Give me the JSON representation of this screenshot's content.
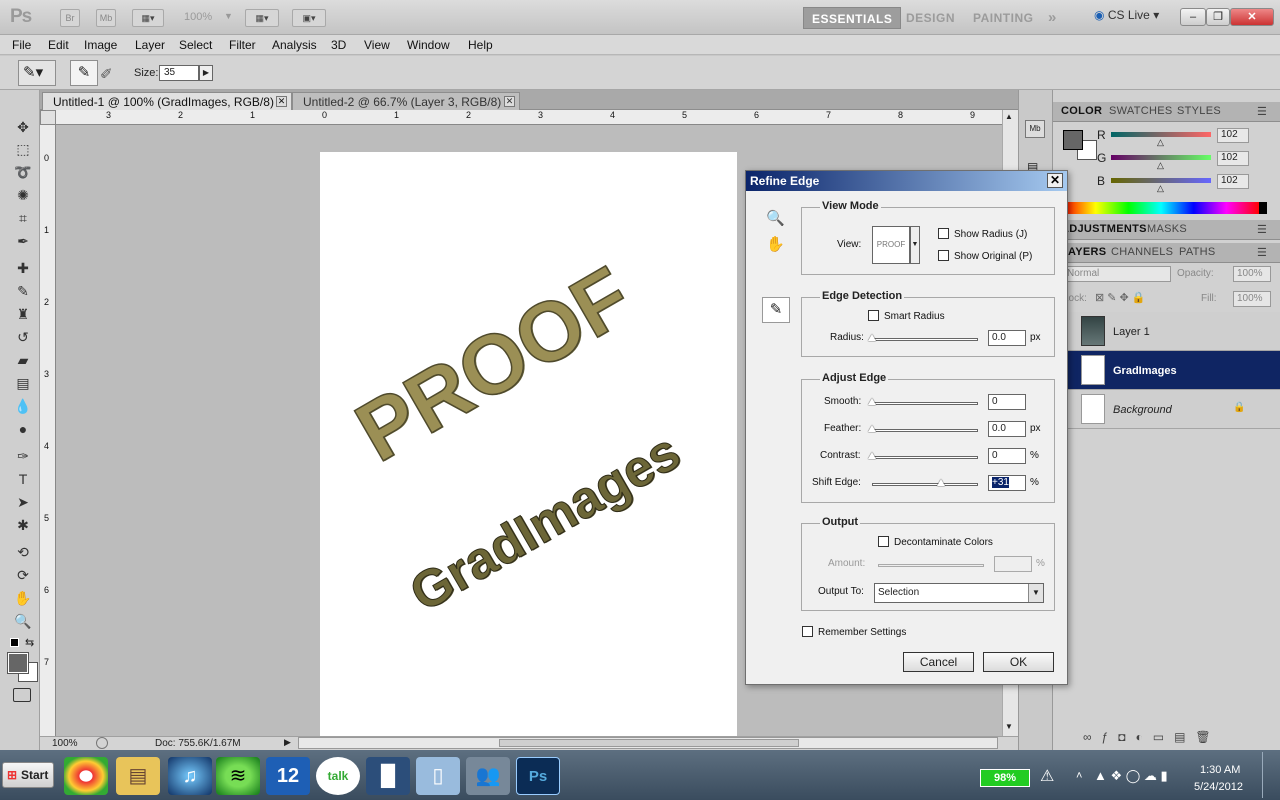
{
  "app": {
    "logo": "Ps",
    "br": "Br",
    "mb": "Mb",
    "zoom": "100%",
    "workspaces": [
      "ESSENTIALS",
      "DESIGN",
      "PAINTING"
    ],
    "more": "»",
    "cs_live": "CS Live"
  },
  "menu": [
    "File",
    "Edit",
    "Image",
    "Layer",
    "Select",
    "Filter",
    "Analysis",
    "3D",
    "View",
    "Window",
    "Help"
  ],
  "options": {
    "size_label": "Size:",
    "size_value": "35"
  },
  "tabs": [
    {
      "label": "Untitled-1 @ 100% (GradImages, RGB/8) *",
      "active": true
    },
    {
      "label": "Untitled-2 @ 66.7% (Layer 3, RGB/8) *",
      "active": false
    }
  ],
  "ruler_h": [
    "3",
    "2",
    "1",
    "0",
    "1",
    "2",
    "3",
    "4",
    "5",
    "6",
    "7",
    "8",
    "9"
  ],
  "ruler_v": [
    "0",
    "1",
    "2",
    "3",
    "4",
    "5",
    "6",
    "7"
  ],
  "canvas": {
    "line1": "PROOF",
    "line2": "GradImages"
  },
  "status": {
    "zoom": "100%",
    "doc": "Doc: 755.6K/1.67M"
  },
  "color_panel": {
    "tabs": [
      "COLOR",
      "SWATCHES",
      "STYLES"
    ],
    "r_label": "R",
    "g_label": "G",
    "b_label": "B",
    "r": "102",
    "g": "102",
    "b": "102"
  },
  "adjust_tabs": [
    "ADJUSTMENTS",
    "MASKS"
  ],
  "layers_panel": {
    "tabs": [
      "LAYERS",
      "CHANNELS",
      "PATHS"
    ],
    "blend": "Normal",
    "opacity_label": "Opacity:",
    "opacity": "100%",
    "lock_label": "Lock:",
    "fill_label": "Fill:",
    "fill": "100%",
    "layers": [
      "Layer 1",
      "GradImages",
      "Background"
    ]
  },
  "dialog": {
    "title": "Refine Edge",
    "view_mode": {
      "title": "View Mode",
      "view_label": "View:",
      "show_radius": "Show Radius (J)",
      "show_original": "Show Original (P)"
    },
    "edge_detection": {
      "title": "Edge Detection",
      "smart_radius": "Smart Radius",
      "radius_label": "Radius:",
      "radius": "0.0",
      "radius_unit": "px"
    },
    "adjust_edge": {
      "title": "Adjust Edge",
      "smooth_label": "Smooth:",
      "smooth": "0",
      "feather_label": "Feather:",
      "feather": "0.0",
      "feather_unit": "px",
      "contrast_label": "Contrast:",
      "contrast": "0",
      "contrast_unit": "%",
      "shift_label": "Shift Edge:",
      "shift": "+31",
      "shift_unit": "%",
      "shift_level": 0.65
    },
    "output": {
      "title": "Output",
      "decontaminate": "Decontaminate Colors",
      "amount_label": "Amount:",
      "amount_unit": "%",
      "output_to_label": "Output To:",
      "output_to": "Selection"
    },
    "remember": "Remember Settings",
    "cancel": "Cancel",
    "ok": "OK"
  },
  "taskbar": {
    "start": "Start",
    "calendar_day": "12",
    "talk": "talk",
    "ps": "Ps",
    "battery": "98%",
    "time": "1:30 AM",
    "date": "5/24/2012"
  }
}
